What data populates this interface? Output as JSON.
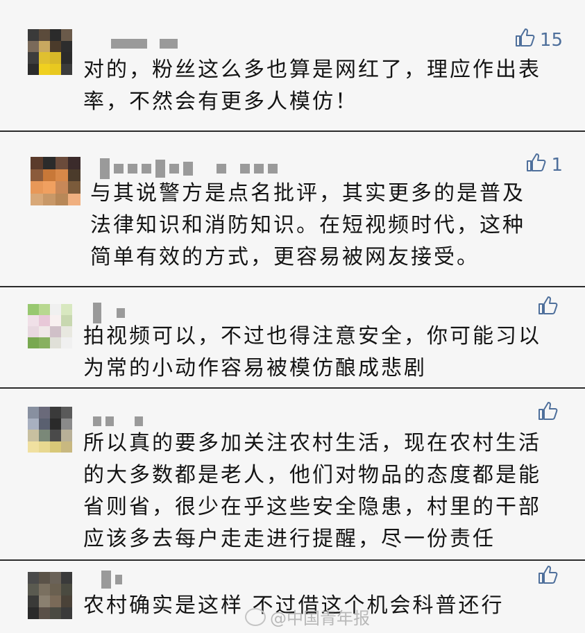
{
  "colors": {
    "like_icon": "#4e6f9b",
    "text": "#141414",
    "card_bg": "#f6f6f6",
    "border": "#2b2b2b"
  },
  "comments": [
    {
      "like_count": "15",
      "lines": [
        "对的，粉丝这么多也算是网红了，理应作出表",
        "率，不然会有更多人模仿！"
      ],
      "avatar_colors": [
        "#3a3a3a",
        "#5b4b3b",
        "#2b2b2b",
        "#6a5a4a",
        "#7a6a5a",
        "#c8a860",
        "#4b3b2b",
        "#2d2d2d",
        "#3d3d3d",
        "#e0c030",
        "#d8b828",
        "#2b2b2b",
        "#2b2b2b",
        "#f0d020",
        "#e8c820",
        "#3b3b3b"
      ]
    },
    {
      "like_count": "1",
      "lines": [
        "与其说警方是点名批评，其实更多的是普及",
        "法律知识和消防知识。在短视频时代，这种",
        "简单有效的方式，更容易被网友接受。"
      ],
      "avatar_colors": [
        "#5b3b2b",
        "#2b2b2b",
        "#6b4b3b",
        "#3b2b2b",
        "#8b5b3b",
        "#c87838",
        "#d88848",
        "#4b3b2b",
        "#e89858",
        "#f0a060",
        "#c88858",
        "#7b5b3b",
        "#d8a878",
        "#c89868",
        "#b88858",
        "#f0b080"
      ]
    },
    {
      "like_count": "",
      "lines": [
        "拍视频可以，不过也得注意安全，你可能习以",
        "为常的小动作容易被模仿酿成悲剧"
      ],
      "avatar_colors": [
        "#98c870",
        "#b8d890",
        "#f0f0f0",
        "#d8e8c0",
        "#f0e0e8",
        "#e8c8d8",
        "#f8f0f0",
        "#c8d8b0",
        "#e8d8e0",
        "#f0e8e8",
        "#d0c0c8",
        "#e8e8e0",
        "#78a850",
        "#88b060",
        "#e0e0d8",
        "#f0f0f0"
      ]
    },
    {
      "like_count": "",
      "lines": [
        "所以真的要多加关注农村生活，现在农村生活",
        "的大多数都是老人，他们对物品的态度都是能",
        "省则省，很少在乎这些安全隐患，村里的干部",
        "应该多去每户走走进行提醒，尽一份责任"
      ],
      "avatar_colors": [
        "#8890a0",
        "#6a6a7a",
        "#3a3a3a",
        "#5a5a5a",
        "#a8b0c0",
        "#5a6070",
        "#2a2a2a",
        "#8a8a8a",
        "#c8c0a0",
        "#7a8878",
        "#4a4a4a",
        "#b8b098",
        "#f0e0a0",
        "#e8d890",
        "#d8c878",
        "#c8b880"
      ]
    },
    {
      "like_count": "",
      "lines": [
        "农村确实是这样 不过借这个机会科普还行"
      ],
      "avatar_colors": [
        "#4a4a4a",
        "#5a5248",
        "#6a6258",
        "#3a3a3a",
        "#5a5a50",
        "#7a7060",
        "#6a6050",
        "#4a4a40",
        "#3a3a38",
        "#8a8070",
        "#7a6a58",
        "#4a4238",
        "#2a2a2a",
        "#5a5048",
        "#4a4a42",
        "#3a3a3a"
      ]
    }
  ],
  "watermark": {
    "text": "@中国青年报"
  }
}
